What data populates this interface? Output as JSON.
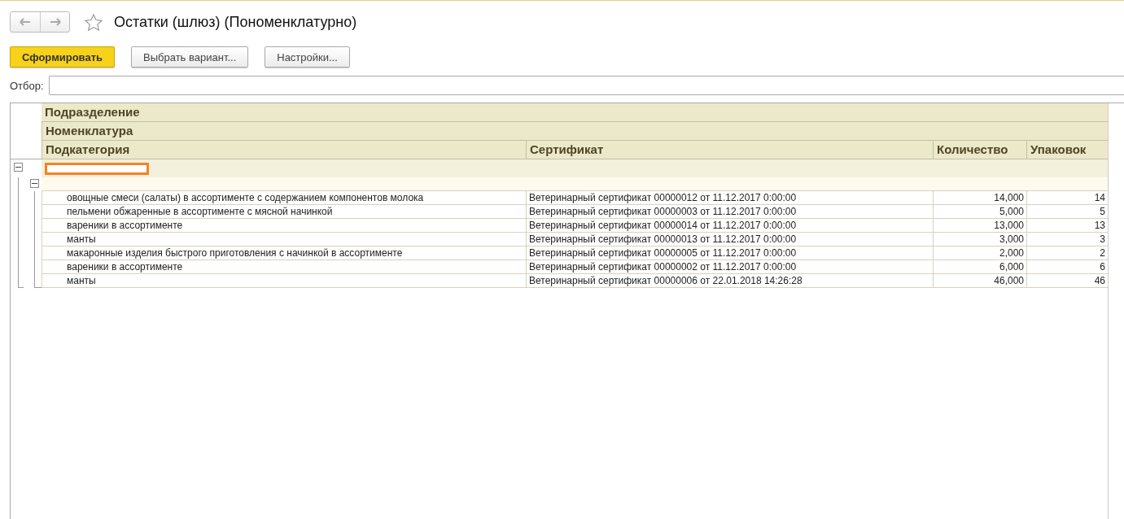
{
  "window": {
    "title": "Остатки (шлюз) (Пономенклатурно)"
  },
  "toolbar": {
    "buttons": [
      {
        "label": "Сформировать",
        "kind": "primary"
      },
      {
        "label": "Выбрать вариант...",
        "kind": "default"
      },
      {
        "label": "Настройки...",
        "kind": "default"
      }
    ]
  },
  "filter": {
    "label": "Отбор:"
  },
  "report": {
    "header_rows": [
      "Подразделение",
      "Номенклатура"
    ],
    "columns": [
      "Подкатегория",
      "Сертификат",
      "Количество",
      "Упаковок"
    ],
    "groups": [
      {
        "expanded": true,
        "children": [
          {
            "expanded": true,
            "rows": [
              {
                "subcategory": "овощные смеси (салаты) в ассортименте с содержанием компонентов молока",
                "certificate": "Ветеринарный сертификат 00000012 от 11.12.2017 0:00:00",
                "quantity": "14,000",
                "packages": "14"
              },
              {
                "subcategory": "пельмени обжаренные в ассортименте с мясной начинкой",
                "certificate": "Ветеринарный сертификат 00000003 от 11.12.2017 0:00:00",
                "quantity": "5,000",
                "packages": "5"
              },
              {
                "subcategory": "вареники в ассортименте",
                "certificate": "Ветеринарный сертификат 00000014 от 11.12.2017 0:00:00",
                "quantity": "13,000",
                "packages": "13"
              },
              {
                "subcategory": "манты",
                "certificate": "Ветеринарный сертификат 00000013 от 11.12.2017 0:00:00",
                "quantity": "3,000",
                "packages": "3"
              },
              {
                "subcategory": "макаронные изделия быстрого приготовления с начинкой в ассортименте",
                "certificate": "Ветеринарный сертификат 00000005 от 11.12.2017 0:00:00",
                "quantity": "2,000",
                "packages": "2"
              },
              {
                "subcategory": "вареники в ассортименте",
                "certificate": "Ветеринарный сертификат 00000002 от 11.12.2017 0:00:00",
                "quantity": "6,000",
                "packages": "6"
              },
              {
                "subcategory": "манты",
                "certificate": "Ветеринарный сертификат 00000006 от 22.01.2018 14:26:28",
                "quantity": "46,000",
                "packages": "46"
              }
            ]
          }
        ]
      }
    ]
  }
}
